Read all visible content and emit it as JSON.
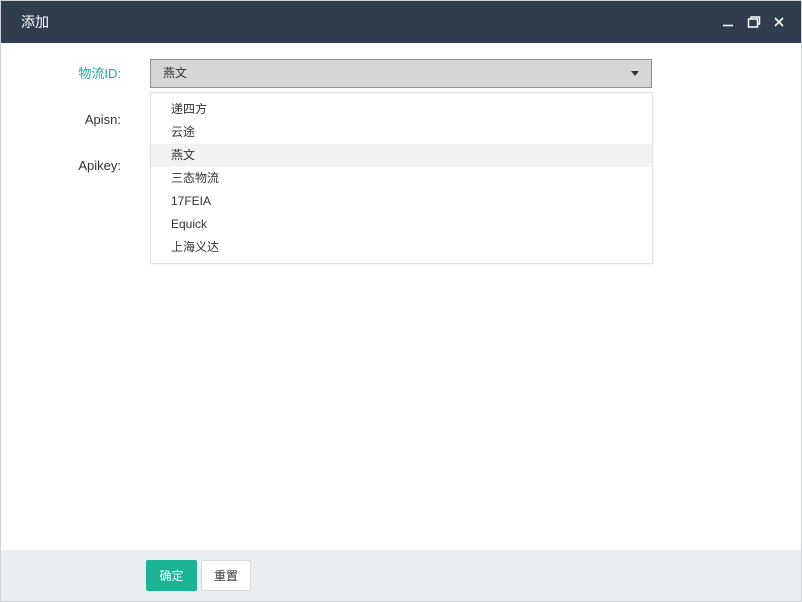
{
  "dialog": {
    "title": "添加",
    "controls": {
      "minimize": "minimize-icon",
      "maximize": "maximize-icon",
      "close": "close-icon"
    }
  },
  "form": {
    "logistics": {
      "label": "物流ID:",
      "selected": "燕文"
    },
    "apisn": {
      "label": "Apisn:"
    },
    "apikey": {
      "label": "Apikey:"
    }
  },
  "dropdown": {
    "options": [
      "递四方",
      "云途",
      "燕文",
      "三态物流",
      "17FEIA",
      "Equick",
      "上海义达"
    ],
    "selected_index": 2
  },
  "footer": {
    "confirm_label": "确定",
    "reset_label": "重置"
  },
  "colors": {
    "titlebar": "#2f3d4f",
    "accent": "#1ab394",
    "active_label": "#1fa89a",
    "footer_bg": "#ebeef1"
  }
}
